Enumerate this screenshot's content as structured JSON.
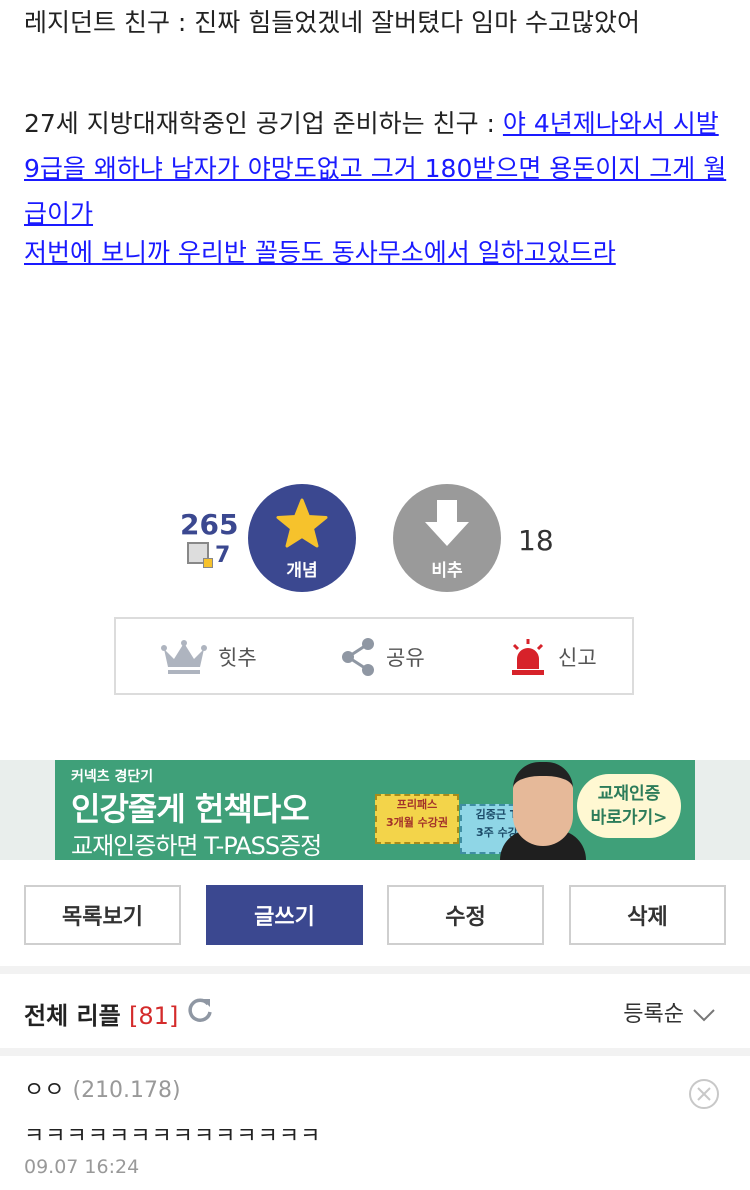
{
  "post": {
    "line1": "레지던트 친구 : 진짜 힘들었겠네 잘버텼다 임마 수고많았어",
    "line2_prefix": "27세 지방대재학중인 공기업 준비하는 친구 : ",
    "line2_link": "야 4년제나와서 시발 9급을 왜하냐 남자가 야망도없고 그거 180받으면 용돈이지 그게 월급이가",
    "line3_link": "저번에 보니까 우리반 꼴등도 동사무소에서 일하고있드라"
  },
  "vote": {
    "up_count": "265",
    "sub_count": "7",
    "up_label": "개념",
    "down_label": "비추",
    "down_count": "18"
  },
  "tools": {
    "hit": "힛추",
    "share": "공유",
    "report": "신고"
  },
  "ad": {
    "brand": "커넥츠 경단기",
    "headline": "인강줄게 헌책다오",
    "subline": "교재인증하면 T-PASS증정",
    "ticket1_a": "프리패스",
    "ticket1_b": "3개월 수강권",
    "ticket2_a": "김중근 T-P",
    "ticket2_b": "3주 수강권",
    "cta_a": "교재인증",
    "cta_b": "바로가기>"
  },
  "buttons": {
    "list": "목록보기",
    "write": "글쓰기",
    "edit": "수정",
    "delete": "삭제"
  },
  "comments_header": {
    "title": "전체 리플",
    "count": "[81]",
    "sort": "등록순"
  },
  "comment": {
    "name": "ㅇㅇ",
    "ip": "(210.178)",
    "text": "ㅋㅋㅋㅋㅋㅋㅋㅋㅋㅋㅋㅋㅋㅋ",
    "date": "09.07 16:24"
  },
  "colors": {
    "accent": "#3b4890",
    "link": "#1a1aff",
    "count_red": "#d42b2b",
    "star": "#f6c22c",
    "report_red": "#d7222a"
  }
}
